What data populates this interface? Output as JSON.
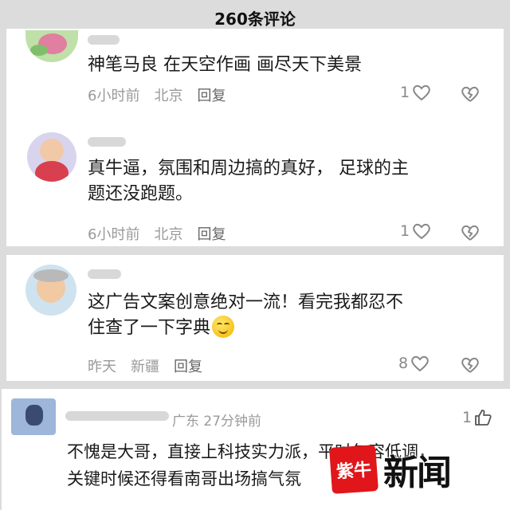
{
  "header": {
    "title": "260条评论"
  },
  "comments": [
    {
      "content_lines": [
        "神笔马良 在天空作画  画尽天下美景"
      ],
      "time": "6小时前",
      "location": "北京",
      "reply": "回复",
      "likes": "1"
    },
    {
      "content_lines": [
        "真牛逼，氛围和周边搞的真好， 足球的主",
        "题还没跑题。"
      ],
      "time": "6小时前",
      "location": "北京",
      "reply": "回复",
      "likes": "1"
    },
    {
      "content_lines": [
        "这广告文案创意绝对一流！看完我都忍不",
        "住查了一下字典"
      ],
      "time": "昨天",
      "location": "新疆",
      "reply": "回复",
      "likes": "8"
    },
    {
      "location_time": "广东 27分钟前",
      "content_lines": [
        "不愧是大哥，直接上科技实力派，平时包容低调，",
        "关键时候还得看南哥出场搞气氛"
      ],
      "likes": "1"
    }
  ],
  "watermark": {
    "logo_text": "紫牛",
    "text": "新闻"
  },
  "colors": {
    "accent": "#e0161b",
    "meta": "#9a9a9a",
    "background": "#dcdcdc"
  }
}
